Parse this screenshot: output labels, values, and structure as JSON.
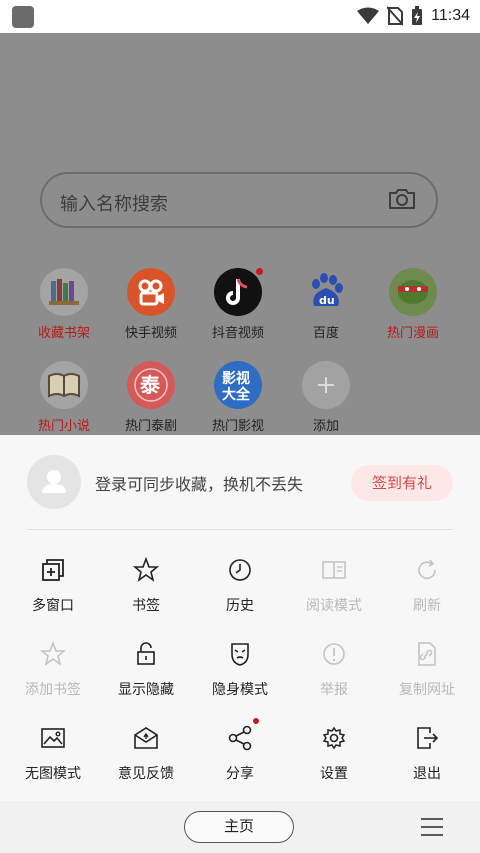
{
  "status_bar": {
    "time": "11:34"
  },
  "search": {
    "placeholder": "输入名称搜索"
  },
  "shortcuts": [
    {
      "label": "收藏书架",
      "color": "#8a3b3b"
    },
    {
      "label": "快手视频",
      "color": "#e8592c"
    },
    {
      "label": "抖音视频",
      "color": "#1a1a1a"
    },
    {
      "label": "百度",
      "color": "#2d57c9"
    },
    {
      "label": "热门漫画",
      "color": "#b5322b"
    },
    {
      "label": "热门小说",
      "color": "#8a3b3b"
    },
    {
      "label": "热门泰剧",
      "color": "#e45a5a"
    },
    {
      "label": "热门影视",
      "color": "#2f6cc4"
    },
    {
      "label": "添加",
      "color": "#9b9b9b"
    }
  ],
  "shortcut_icons": {
    "kuaishou": "快",
    "tai": "泰",
    "yingshi": "影视大全",
    "baidu": "du"
  },
  "login": {
    "prompt": "登录可同步收藏，换机不丢失",
    "signin_label": "签到有礼"
  },
  "menu": [
    {
      "label": "多窗口",
      "icon": "multi-window-icon",
      "enabled": true
    },
    {
      "label": "书签",
      "icon": "star-icon",
      "enabled": true
    },
    {
      "label": "历史",
      "icon": "clock-icon",
      "enabled": true
    },
    {
      "label": "阅读模式",
      "icon": "reader-icon",
      "enabled": false
    },
    {
      "label": "刷新",
      "icon": "refresh-icon",
      "enabled": false
    },
    {
      "label": "添加书签",
      "icon": "star-outline-icon",
      "enabled": false
    },
    {
      "label": "显示隐藏",
      "icon": "lock-icon",
      "enabled": true
    },
    {
      "label": "隐身模式",
      "icon": "mask-icon",
      "enabled": true
    },
    {
      "label": "举报",
      "icon": "alert-icon",
      "enabled": false
    },
    {
      "label": "复制网址",
      "icon": "copy-link-icon",
      "enabled": false
    },
    {
      "label": "无图模式",
      "icon": "image-icon",
      "enabled": true
    },
    {
      "label": "意见反馈",
      "icon": "feedback-icon",
      "enabled": true
    },
    {
      "label": "分享",
      "icon": "share-icon",
      "enabled": true
    },
    {
      "label": "设置",
      "icon": "gear-icon",
      "enabled": true
    },
    {
      "label": "退出",
      "icon": "exit-icon",
      "enabled": true
    }
  ],
  "bottom": {
    "home_label": "主页"
  }
}
